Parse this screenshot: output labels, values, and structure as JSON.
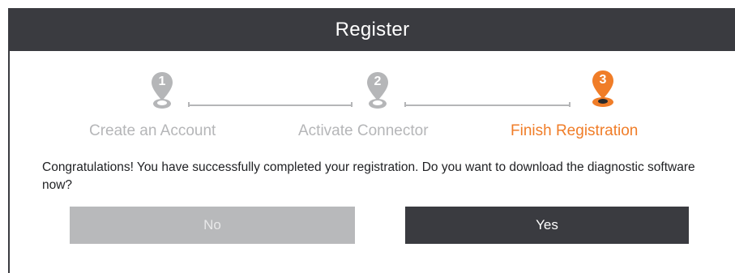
{
  "dialog": {
    "title": "Register"
  },
  "steps": [
    {
      "number": "1",
      "label": "Create an Account",
      "state": "completed-gray"
    },
    {
      "number": "2",
      "label": "Activate Connector",
      "state": "completed-gray"
    },
    {
      "number": "3",
      "label": "Finish Registration",
      "state": "active"
    }
  ],
  "colors": {
    "title_bar": "#3a3b40",
    "inactive_step": "#b5b6b8",
    "active_step": "#f07d28",
    "no_button": "#b8b9bb",
    "yes_button": "#3a3b40"
  },
  "message": "Congratulations! You have successfully completed your registration. Do you want to download the diagnostic software now?",
  "buttons": {
    "no_label": "No",
    "yes_label": "Yes"
  },
  "icons": {
    "step_marker": "map-pin-icon"
  }
}
